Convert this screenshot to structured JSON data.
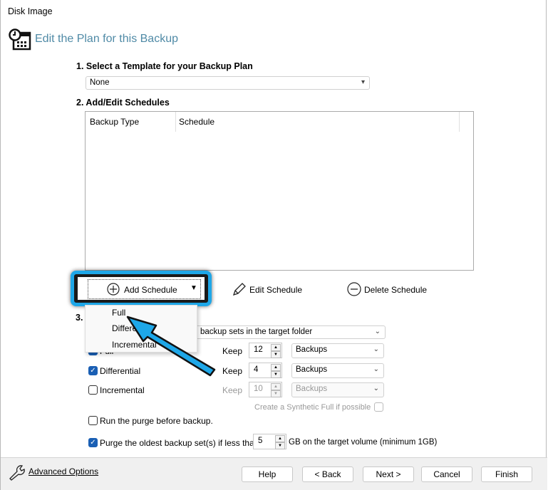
{
  "window": {
    "title": "Disk Image"
  },
  "header": {
    "title": "Edit the Plan for this Backup",
    "icon": "calendar-clock-icon",
    "color": "#4f8aa6"
  },
  "section1": {
    "label": "1. Select a Template for your Backup Plan",
    "template_value": "None"
  },
  "section2": {
    "label": "2. Add/Edit Schedules",
    "columns": [
      "Backup Type",
      "Schedule"
    ],
    "add_label": "Add Schedule",
    "edit_label": "Edit Schedule",
    "delete_label": "Delete Schedule"
  },
  "add_menu": {
    "items": [
      "Full",
      "Differential",
      "Incremental"
    ]
  },
  "section3": {
    "label": "3.",
    "purge_mode": "ng backup sets in the target folder",
    "rows": [
      {
        "label": "Full",
        "checked": true,
        "keep": "Keep",
        "count": "12",
        "unit": "Backups",
        "enabled": true
      },
      {
        "label": "Differential",
        "checked": true,
        "keep": "Keep",
        "count": "4",
        "unit": "Backups",
        "enabled": true
      },
      {
        "label": "Incremental",
        "checked": false,
        "keep": "Keep",
        "count": "10",
        "unit": "Backups",
        "enabled": false
      }
    ],
    "synthetic_label": "Create a Synthetic Full if possible",
    "run_purge_label": "Run the purge before backup.",
    "purge_oldest_label": "Purge the oldest backup set(s) if less than",
    "purge_gb": "5",
    "purge_suffix": "GB on the target volume (minimum 1GB)"
  },
  "footer": {
    "advanced": "Advanced Options",
    "help": "Help",
    "back": "< Back",
    "next": "Next >",
    "cancel": "Cancel",
    "finish": "Finish"
  },
  "annotation": {
    "highlight_color": "#1ea7e8"
  }
}
